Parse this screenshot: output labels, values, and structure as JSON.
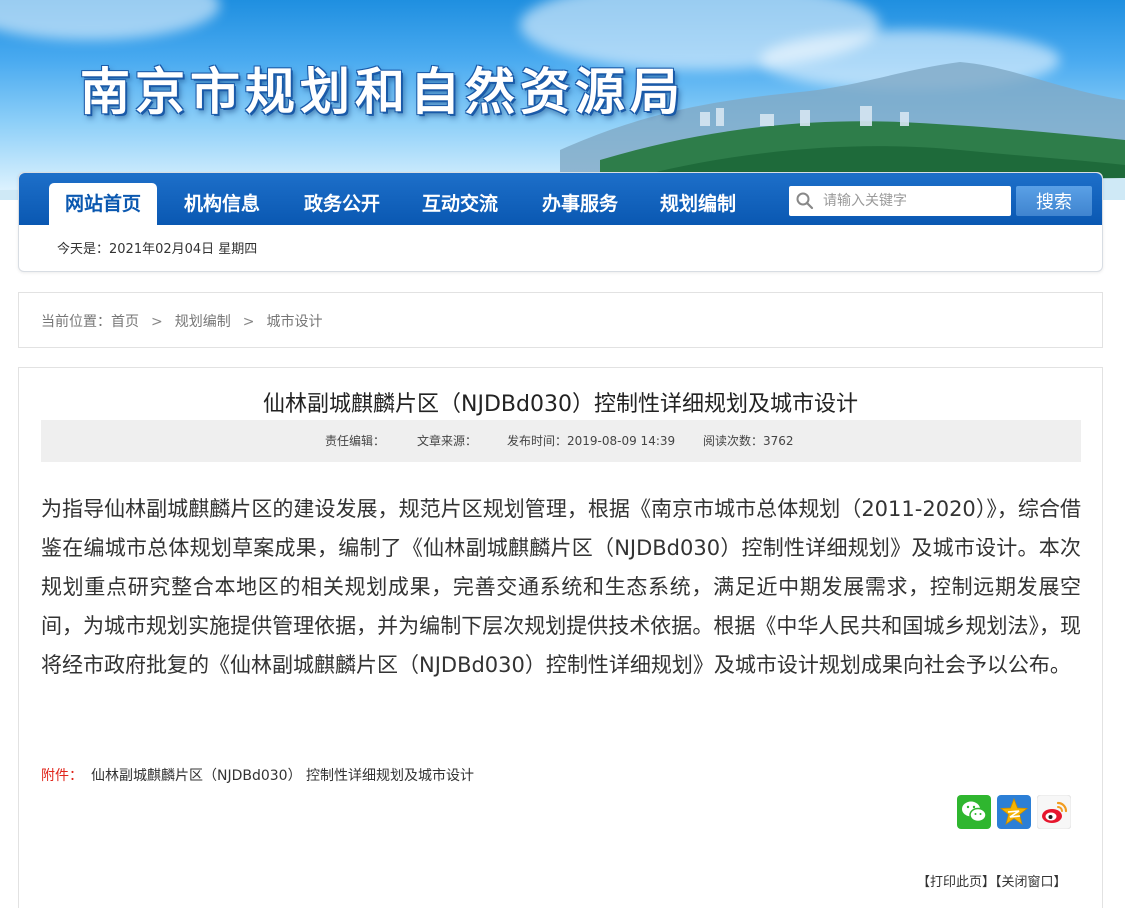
{
  "site": {
    "title": "南京市规划和自然资源局"
  },
  "nav": {
    "items": [
      {
        "label": "网站首页",
        "active": true
      },
      {
        "label": "机构信息",
        "active": false
      },
      {
        "label": "政务公开",
        "active": false
      },
      {
        "label": "互动交流",
        "active": false
      },
      {
        "label": "办事服务",
        "active": false
      },
      {
        "label": "规划编制",
        "active": false
      }
    ],
    "search_placeholder": "请输入关键字",
    "search_button": "搜索",
    "date_text": "今天是：2021年02月04日 星期四"
  },
  "breadcrumb": {
    "prefix": "当前位置：",
    "items": [
      "首页",
      "规划编制",
      "城市设计"
    ],
    "separator": ">"
  },
  "article": {
    "title": "仙林副城麒麟片区（NJDBd030）控制性详细规划及城市设计",
    "meta": {
      "editor": "责任编辑：",
      "source": "文章来源：",
      "published": "发布时间：2019-08-09 14:39",
      "views": "阅读次数：3762"
    },
    "body": "为指导仙林副城麒麟片区的建设发展，规范片区规划管理，根据《南京市城市总体规划（2011-2020）》，综合借鉴在编城市总体规划草案成果，编制了《仙林副城麒麟片区（NJDBd030）控制性详细规划》及城市设计。本次规划重点研究整合本地区的相关规划成果，完善交通系统和生态系统，满足近中期发展需求，控制远期发展空间，为城市规划实施提供管理依据，并为编制下层次规划提供技术依据。根据《中华人民共和国城乡规划法》，现将经市政府批复的《仙林副城麒麟片区（NJDBd030）控制性详细规划》及城市设计规划成果向社会予以公布。",
    "attachment_label": "附件：",
    "attachment_link": "仙林副城麒麟片区（NJDBd030） 控制性详细规划及城市设计"
  },
  "share": {
    "icons": [
      "wechat-icon",
      "qzone-icon",
      "weibo-icon"
    ],
    "colors": {
      "wechat": "#2fb62f",
      "qzone": "#f5b400",
      "weibo": "#e6162d"
    }
  },
  "actions": {
    "print": "【打印此页】",
    "close": "【关闭窗口】"
  },
  "colors": {
    "nav_bg": "#0a58b2",
    "accent_red": "#e0251b"
  }
}
